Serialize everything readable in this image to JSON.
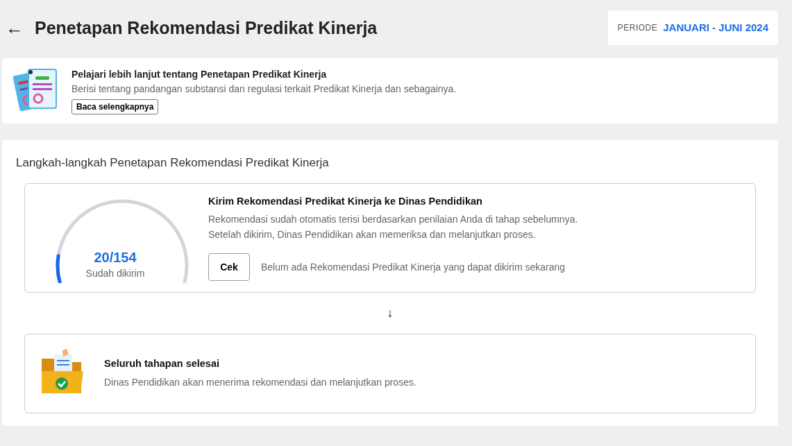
{
  "header": {
    "back_icon": "←",
    "title": "Penetapan Rekomendasi Predikat Kinerja",
    "period_label": "PERIODE",
    "period_value": "JANUARI - JUNI 2024"
  },
  "info_banner": {
    "title": "Pelajari lebih lanjut tentang Penetapan Predikat Kinerja",
    "description": "Berisi tentang pandangan substansi dan regulasi terkait Predikat Kinerja dan sebagainya.",
    "button": "Baca selengkapnya"
  },
  "steps_section": {
    "title": "Langkah-langkah Penetapan Rekomendasi Predikat Kinerja",
    "steps": [
      {
        "kind": "gauge",
        "gauge": {
          "value": "20/154",
          "caption": "Sudah dikirim",
          "level": 0.13
        },
        "title": "Kirim Rekomendasi Predikat Kinerja ke Dinas Pendidikan",
        "description_lines": [
          "Rekomendasi sudah otomatis terisi berdasarkan penilaian Anda di tahap sebelumnya.",
          "Setelah dikirim, Dinas Pendidikan akan memeriksa dan melanjutkan proses."
        ],
        "button": "Cek",
        "note": "Belum ada Rekomendasi Predikat Kinerja yang dapat dikirim sekarang"
      },
      {
        "kind": "illustration",
        "title": "Seluruh tahapan selesai",
        "description_lines": [
          "Dinas Pendidikan akan menerima rekomendasi dan melanjutkan proses."
        ]
      }
    ],
    "connector": "↓"
  }
}
